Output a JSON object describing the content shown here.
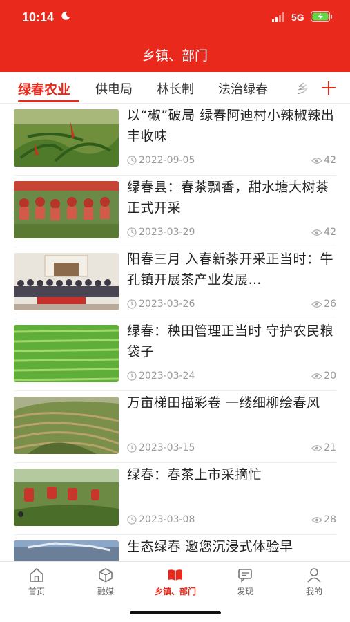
{
  "status_bar": {
    "time": "10:14",
    "network": "5G",
    "icons": [
      "moon-icon",
      "signal-icon",
      "battery-charging-icon"
    ]
  },
  "header": {
    "title": "乡镇、部门"
  },
  "colors": {
    "brand": "#e8291c",
    "muted": "#999999"
  },
  "tabs": [
    {
      "label": "绿春农业",
      "active": true
    },
    {
      "label": "供电局"
    },
    {
      "label": "林长制"
    },
    {
      "label": "法治绿春"
    },
    {
      "label": "乡"
    }
  ],
  "tab_add_icon": "plus-icon",
  "articles": [
    {
      "title": "以“椒”破局 绿春阿迪村小辣椒辣出丰收味",
      "date": "2022-09-05",
      "views": "42"
    },
    {
      "title": "绿春县：春茶飘香，甜水塘大树茶正式开采",
      "date": "2023-03-29",
      "views": "42"
    },
    {
      "title": "阳春三月 入春新茶开采正当时：牛孔镇开展茶产业发展…",
      "date": "2023-03-26",
      "views": "26"
    },
    {
      "title": "绿春：秧田管理正当时 守护农民粮袋子",
      "date": "2023-03-24",
      "views": "20"
    },
    {
      "title": "万亩梯田描彩卷 一缕细柳绘春风",
      "date": "2023-03-15",
      "views": "21"
    },
    {
      "title": "绿春：春茶上市采摘忙",
      "date": "2023-03-08",
      "views": "28"
    },
    {
      "title": "生态绿春 邀您沉浸式体验早",
      "date": "",
      "views": ""
    }
  ],
  "tabbar": [
    {
      "label": "首页",
      "icon": "home-icon"
    },
    {
      "label": "融媒",
      "icon": "cube-icon"
    },
    {
      "label": "乡镇、部门",
      "icon": "book-icon",
      "active": true
    },
    {
      "label": "发现",
      "icon": "message-icon"
    },
    {
      "label": "我的",
      "icon": "user-icon"
    }
  ]
}
